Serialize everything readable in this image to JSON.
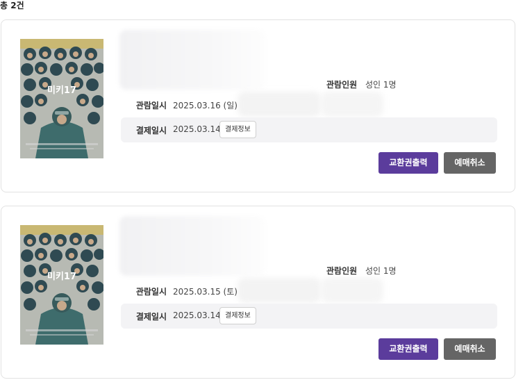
{
  "summary": {
    "label": "총 2건"
  },
  "bookings": [
    {
      "poster_title": "미키17",
      "viewers_label": "관람인원",
      "viewers_value": "성인 1명",
      "watch_label": "관람일시",
      "watch_date": "2025.03.16 (일)",
      "pay_label": "결제일시",
      "pay_date": "2025.03.14",
      "pay_info_button": "결제정보",
      "print_button": "교환권출력",
      "cancel_button": "예매취소"
    },
    {
      "poster_title": "미키17",
      "viewers_label": "관람인원",
      "viewers_value": "성인 1명",
      "watch_label": "관람일시",
      "watch_date": "2025.03.15 (토)",
      "pay_label": "결제일시",
      "pay_date": "2025.03.14",
      "pay_info_button": "결제정보",
      "print_button": "교환권출력",
      "cancel_button": "예매취소"
    }
  ],
  "colors": {
    "print_button": "#5b3c9c",
    "cancel_button": "#656565",
    "pay_row_bg": "#f3f3f5",
    "card_border": "#e2e2e2"
  }
}
